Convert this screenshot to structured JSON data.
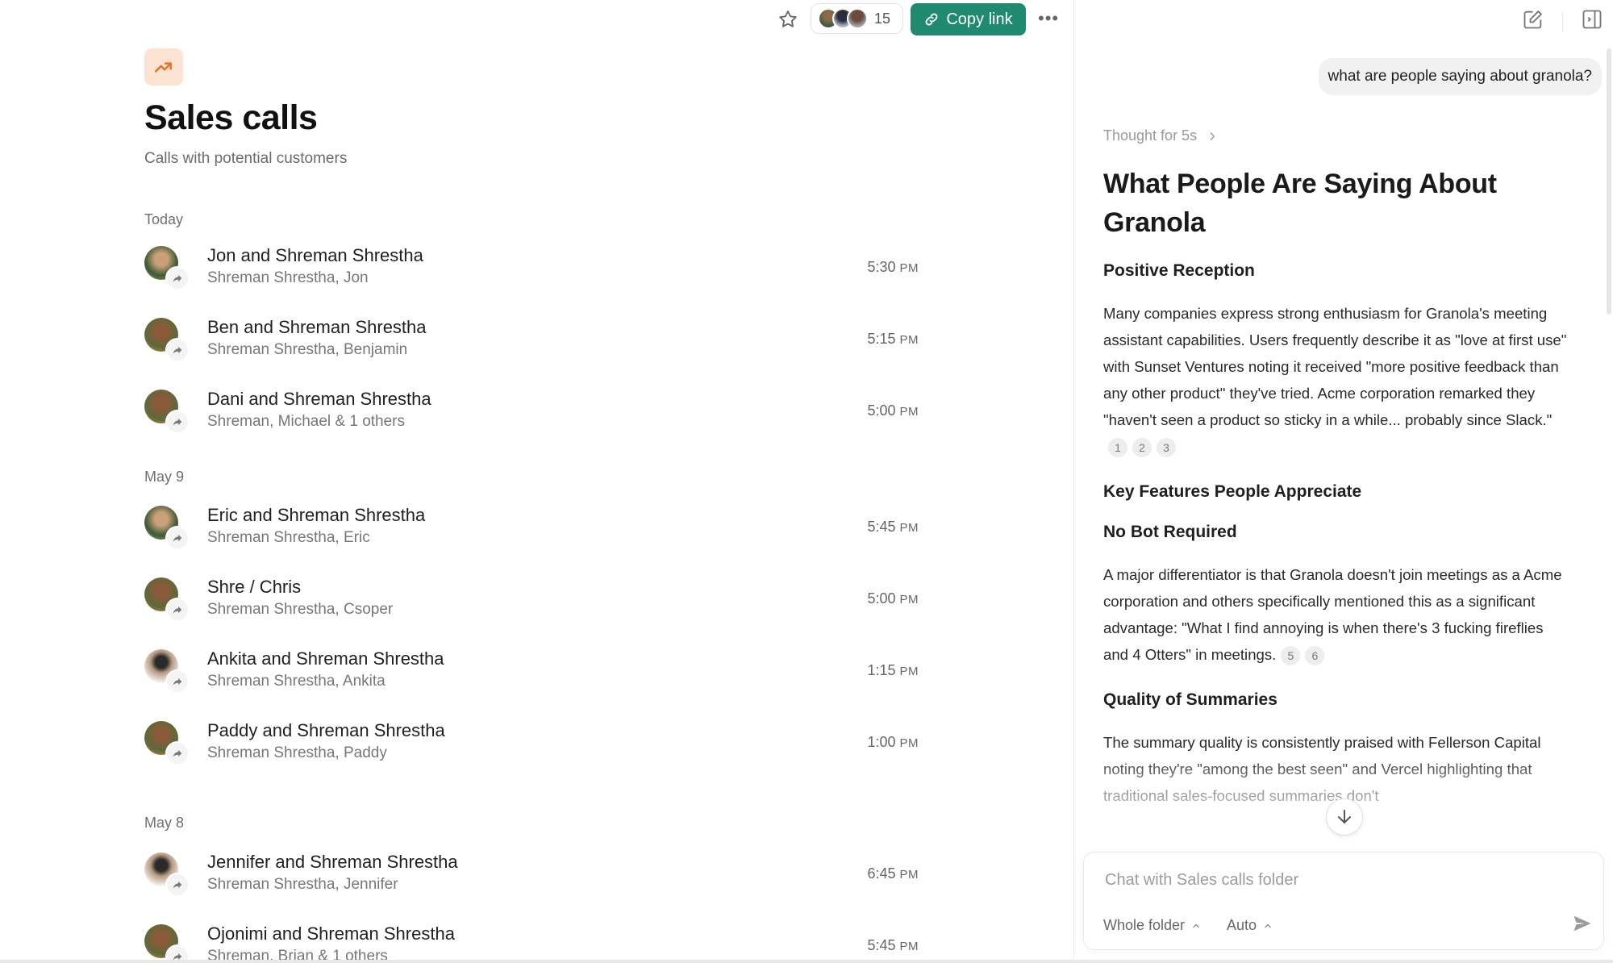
{
  "toolbar": {
    "participant_count": "15",
    "copy_link_label": "Copy link"
  },
  "page": {
    "title": "Sales calls",
    "subtitle": "Calls with potential customers"
  },
  "groups": [
    {
      "label": "Today",
      "calls": [
        {
          "name": "Jon and Shreman Shrestha",
          "people": "Shreman Shrestha, Jon",
          "time": "5:30",
          "ampm": "PM"
        },
        {
          "name": "Ben and Shreman Shrestha",
          "people": "Shreman Shrestha, Benjamin",
          "time": "5:15",
          "ampm": "PM"
        },
        {
          "name": "Dani and Shreman Shrestha",
          "people": "Shreman, Michael & 1 others",
          "time": "5:00",
          "ampm": "PM"
        }
      ]
    },
    {
      "label": "May 9",
      "calls": [
        {
          "name": "Eric and Shreman Shrestha",
          "people": "Shreman Shrestha, Eric",
          "time": "5:45",
          "ampm": "PM"
        },
        {
          "name": "Shre / Chris",
          "people": "Shreman Shrestha, Csoper",
          "time": "5:00",
          "ampm": "PM"
        },
        {
          "name": "Ankita and Shreman Shrestha",
          "people": "Shreman Shrestha, Ankita",
          "time": "1:15",
          "ampm": "PM"
        },
        {
          "name": "Paddy and Shreman Shrestha",
          "people": "Shreman Shrestha, Paddy",
          "time": "1:00",
          "ampm": "PM"
        }
      ]
    },
    {
      "label": "May 8",
      "calls": [
        {
          "name": "Jennifer and Shreman Shrestha",
          "people": "Shreman Shrestha, Jennifer",
          "time": "6:45",
          "ampm": "PM"
        },
        {
          "name": "Ojonimi and Shreman Shrestha",
          "people": "Shreman, Brian & 1 others",
          "time": "5:45",
          "ampm": "PM"
        }
      ]
    }
  ],
  "chat": {
    "user_message": "what are people saying about granola?",
    "thought_label": "Thought for 5s",
    "heading": "What People Are Saying About Granola",
    "section1_title": "Positive Reception",
    "section1_text": "Many companies express strong enthusiasm for Granola's meeting assistant capabilities. Users frequently describe it as \"love at first use\" with  Sunset  Ventures noting it received \"more positive feedback than any other product\" they've tried. Acme corporation  remarked they \"haven't seen a product so sticky in a while... probably since Slack.\"",
    "section1_cites": [
      "1",
      "2",
      "3"
    ],
    "section2_title": "Key Features People Appreciate",
    "section3_title": "No Bot Required",
    "section3_text": "A major differentiator is that Granola doesn't join meetings as a Acme corporation  and others specifically mentioned this as a significant advantage: \"What I find annoying is when there's 3 fucking fireflies and 4 Otters\" in meetings.",
    "section3_cites": [
      "5",
      "6"
    ],
    "section4_title": "Quality of Summaries",
    "section4_text": "The summary quality is consistently praised with Fellerson Capital noting they're \"among the best seen\" and Vercel highlighting that traditional sales-focused summaries don't",
    "input_placeholder": "Chat with Sales calls folder",
    "scope_label": "Whole folder",
    "model_label": "Auto"
  },
  "colors": {
    "accent": "#1f8a70",
    "folder_icon_bg": "#fde3d2",
    "folder_icon_fg": "#e8742c"
  },
  "icons": {
    "star": "star-icon",
    "link": "link-icon",
    "more": "more-icon",
    "folder": "trending-up-icon",
    "share": "share-arrow-icon",
    "edit": "edit-icon",
    "sidebar": "sidebar-toggle-icon",
    "thought": "chevron-right-icon",
    "scroll": "arrow-down-icon",
    "send": "send-icon"
  }
}
